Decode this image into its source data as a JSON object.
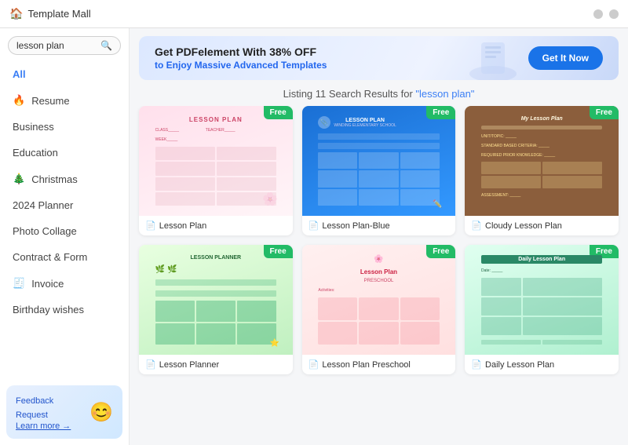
{
  "app": {
    "title": "Template Mall",
    "title_icon": "🏠"
  },
  "titlebar": {
    "min_label": "−",
    "close_label": "×"
  },
  "search": {
    "value": "lesson plan",
    "placeholder": "lesson plan"
  },
  "sidebar": {
    "items": [
      {
        "id": "all",
        "label": "All",
        "icon": "",
        "active": true
      },
      {
        "id": "resume",
        "label": "Resume",
        "icon": "🔥",
        "active": false
      },
      {
        "id": "business",
        "label": "Business",
        "icon": "",
        "active": false
      },
      {
        "id": "education",
        "label": "Education",
        "icon": "",
        "active": false
      },
      {
        "id": "christmas",
        "label": "Christmas",
        "icon": "🎄",
        "active": false
      },
      {
        "id": "planner2024",
        "label": "2024 Planner",
        "icon": "",
        "active": false
      },
      {
        "id": "photocollage",
        "label": "Photo Collage",
        "icon": "",
        "active": false
      },
      {
        "id": "contract",
        "label": "Contract & Form",
        "icon": "",
        "active": false
      },
      {
        "id": "invoice",
        "label": "Invoice",
        "icon": "🧾",
        "active": false
      },
      {
        "id": "birthday",
        "label": "Birthday wishes",
        "icon": "",
        "active": false
      }
    ]
  },
  "feedback": {
    "title": "Feedback Request",
    "link_label": "Learn more →",
    "emoji": "😊"
  },
  "banner": {
    "title": "Get PDFelement With 38% OFF",
    "subtitle": "to Enjoy Massive ",
    "highlight": "Advanced Templates",
    "button_label": "Get It Now"
  },
  "results": {
    "label": "Listing 11 Search Results for ",
    "query": "\"lesson plan\""
  },
  "templates": [
    {
      "id": "t1",
      "name": "Lesson Plan",
      "badge": "Free",
      "thumb_class": "thumb-1",
      "icon": "📄"
    },
    {
      "id": "t2",
      "name": "Lesson Plan-Blue",
      "badge": "Free",
      "thumb_class": "thumb-2",
      "icon": "📄"
    },
    {
      "id": "t3",
      "name": "Cloudy Lesson Plan",
      "badge": "Free",
      "thumb_class": "thumb-3",
      "icon": "📄"
    },
    {
      "id": "t4",
      "name": "Lesson Planner",
      "badge": "Free",
      "thumb_class": "thumb-4",
      "icon": "📄"
    },
    {
      "id": "t5",
      "name": "Lesson Plan Preschool",
      "badge": "Free",
      "thumb_class": "thumb-5",
      "icon": "📄"
    },
    {
      "id": "t6",
      "name": "Daily Lesson Plan",
      "badge": "Free",
      "thumb_class": "thumb-6",
      "icon": "📄"
    }
  ]
}
